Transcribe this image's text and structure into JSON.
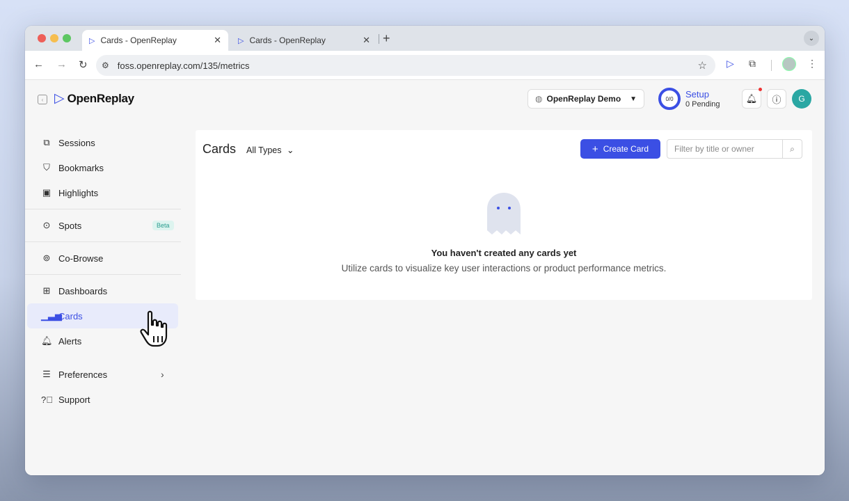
{
  "browser": {
    "tabs": [
      {
        "title": "Cards - OpenReplay",
        "close": "✕"
      },
      {
        "title": "Cards - OpenReplay",
        "close": "✕"
      }
    ],
    "new_tab": "+",
    "url": "foss.openreplay.com/135/metrics"
  },
  "header": {
    "logo_text": "OpenReplay",
    "project": "OpenReplay Demo",
    "setup_progress": "0/0",
    "setup_title": "Setup",
    "setup_pending": "0 Pending",
    "avatar_initial": "G"
  },
  "sidebar": {
    "items": [
      {
        "label": "Sessions",
        "icon": "play-square-icon"
      },
      {
        "label": "Bookmarks",
        "icon": "bookmark-icon"
      },
      {
        "label": "Highlights",
        "icon": "highlight-icon"
      },
      {
        "label": "Spots",
        "icon": "spot-icon",
        "badge": "Beta"
      },
      {
        "label": "Co-Browse",
        "icon": "broadcast-icon"
      },
      {
        "label": "Dashboards",
        "icon": "grid-icon"
      },
      {
        "label": "Cards",
        "icon": "bar-chart-icon",
        "active": true
      },
      {
        "label": "Alerts",
        "icon": "bell-icon"
      },
      {
        "label": "Preferences",
        "icon": "sliders-icon"
      },
      {
        "label": "Support",
        "icon": "help-circle-icon"
      }
    ]
  },
  "main": {
    "title": "Cards",
    "type_filter": "All Types",
    "create_button": "Create Card",
    "search_placeholder": "Filter by title or owner",
    "empty_title": "You haven't created any cards yet",
    "empty_subtitle": "Utilize cards to visualize key user interactions or product performance metrics."
  },
  "colors": {
    "accent": "#3b4fe4",
    "active_bg": "#e8ebfb",
    "avatar": "#2aa7a3"
  }
}
